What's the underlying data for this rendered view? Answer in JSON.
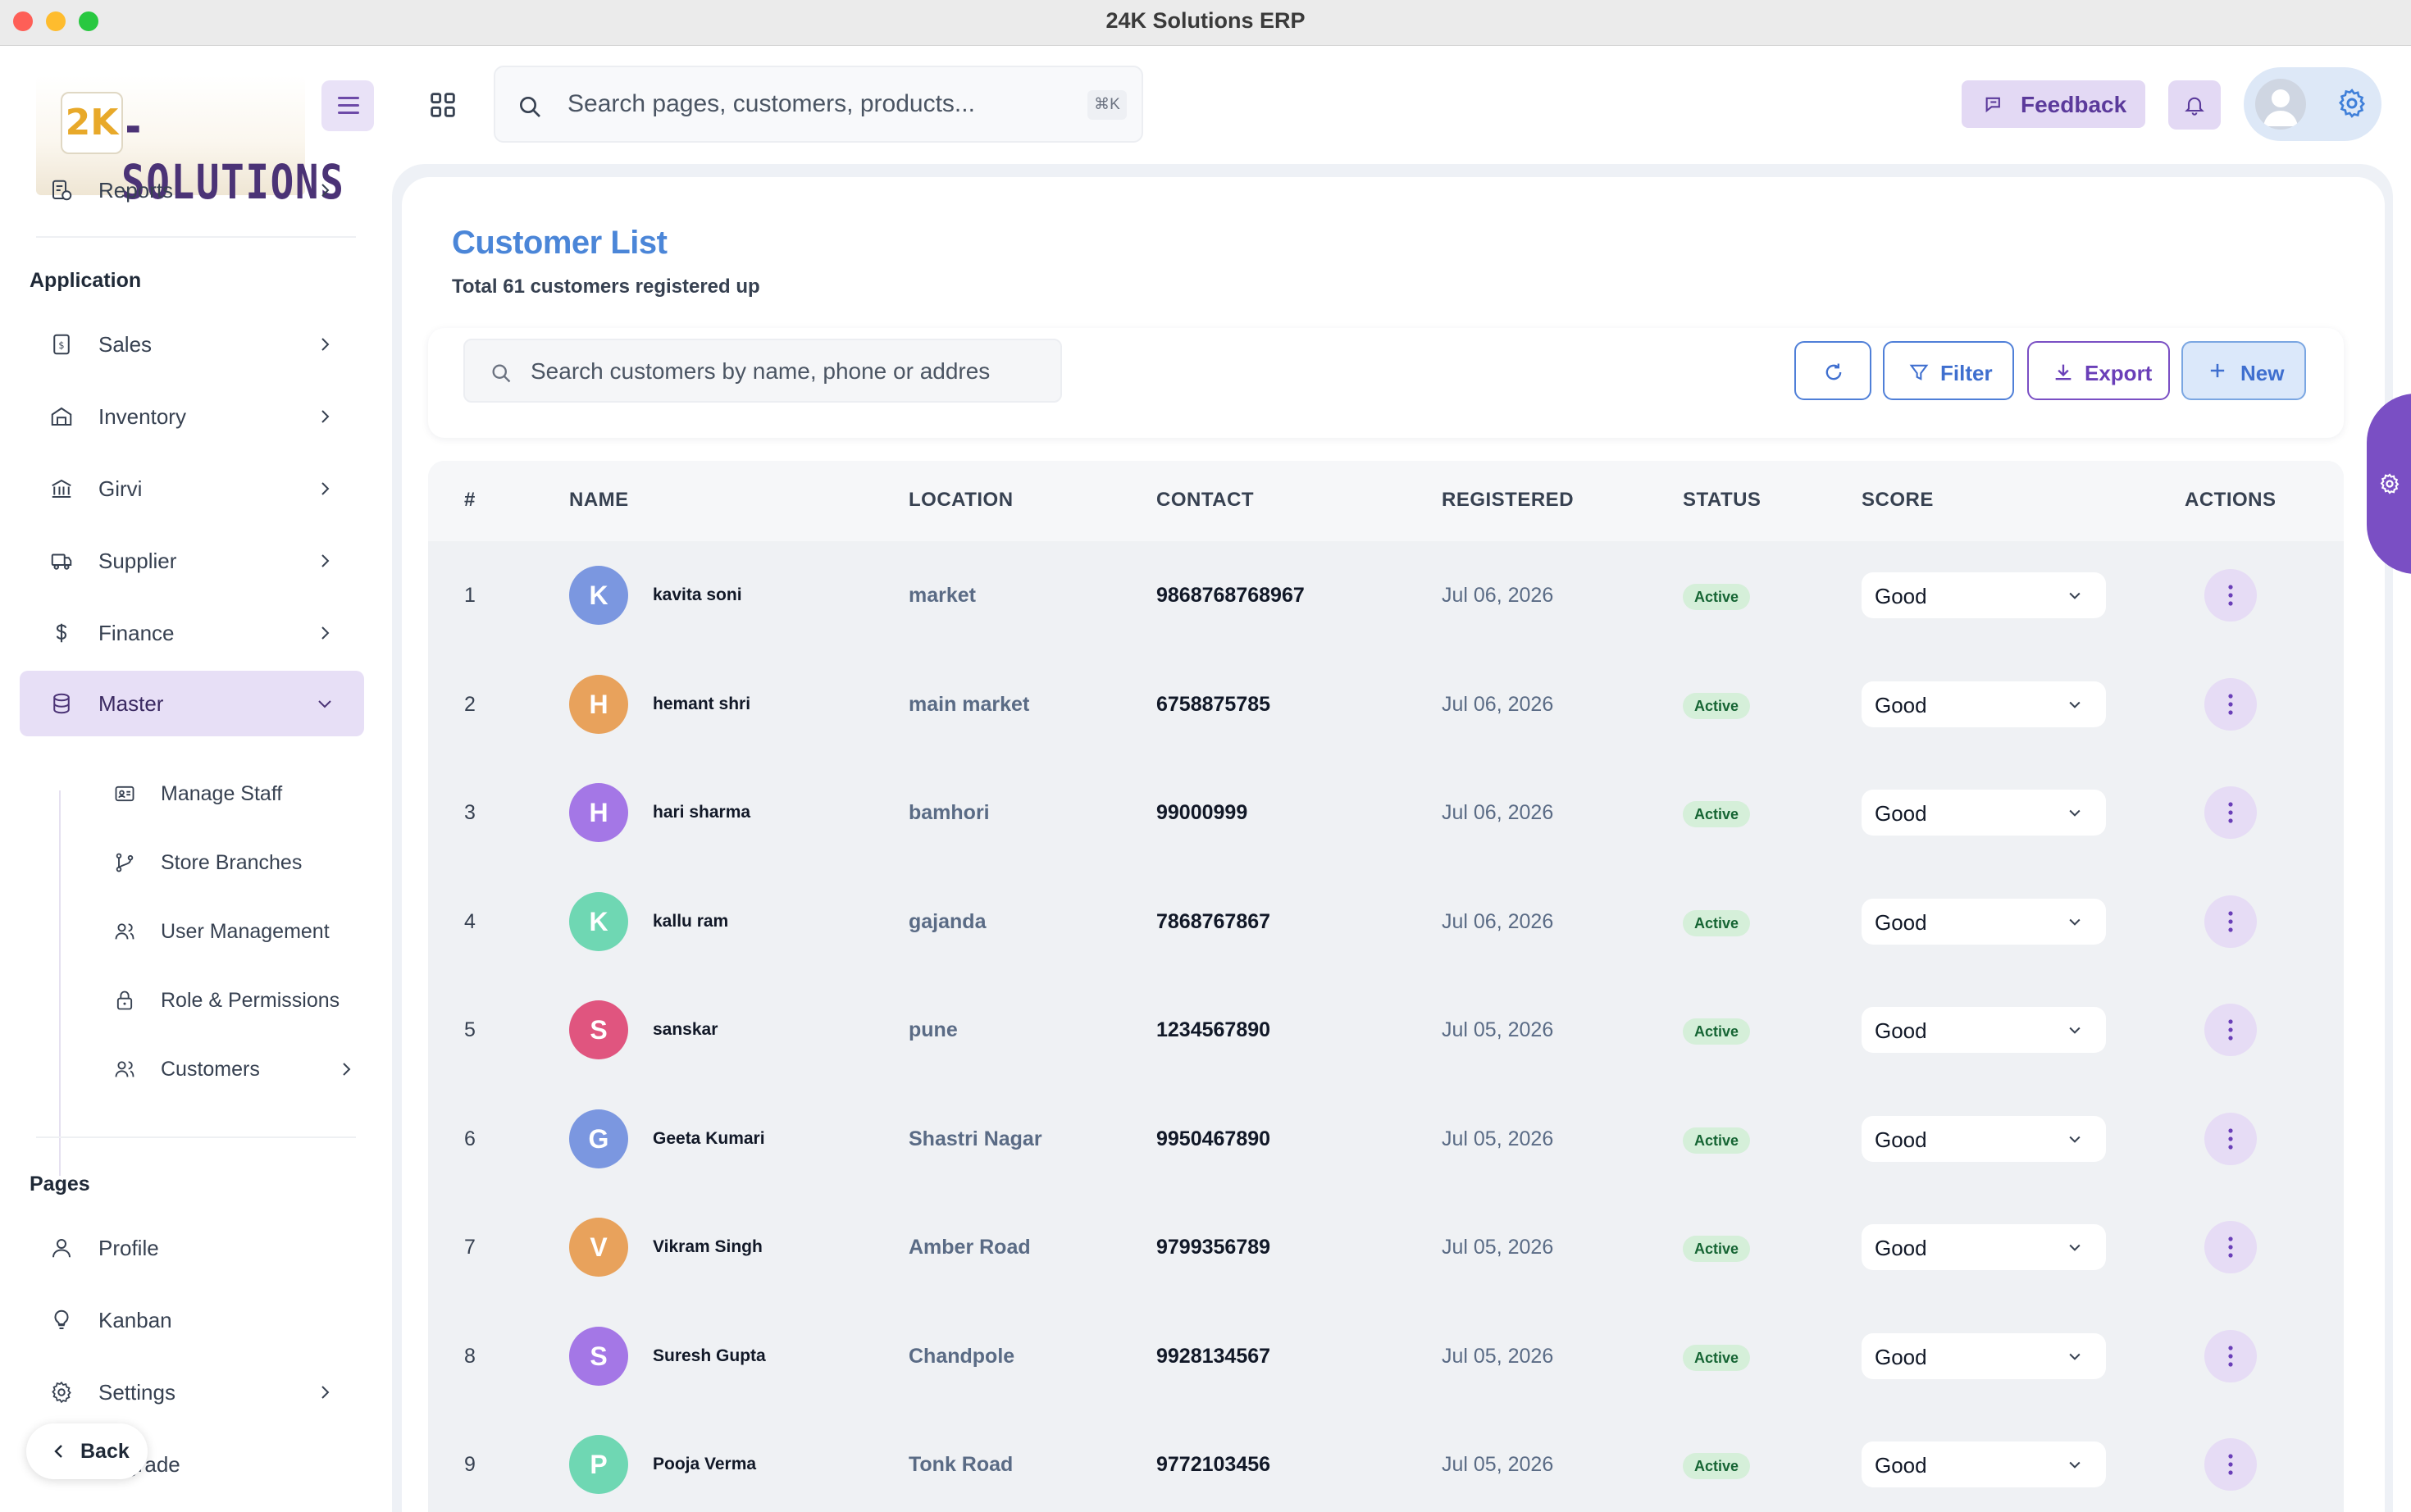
{
  "window": {
    "title": "24K Solutions ERP"
  },
  "logo": {
    "badge": "2K",
    "text": "-SOLUTIONS"
  },
  "sidebar": {
    "reports": "Reports",
    "section_application": "Application",
    "items": [
      {
        "label": "Sales"
      },
      {
        "label": "Inventory"
      },
      {
        "label": "Girvi"
      },
      {
        "label": "Supplier"
      },
      {
        "label": "Finance"
      },
      {
        "label": "Master"
      }
    ],
    "master_sub": [
      {
        "label": "Manage Staff"
      },
      {
        "label": "Store Branches"
      },
      {
        "label": "User Management"
      },
      {
        "label": "Role & Permissions"
      },
      {
        "label": "Customers"
      }
    ],
    "section_pages": "Pages",
    "pages": [
      {
        "label": "Profile"
      },
      {
        "label": "Kanban"
      },
      {
        "label": "Settings"
      },
      {
        "label": "Upgrade"
      }
    ],
    "back_label": "Back"
  },
  "header": {
    "search_placeholder": "Search pages, customers, products...",
    "shortcut": "⌘K",
    "feedback_label": "Feedback"
  },
  "page": {
    "title": "Customer List",
    "subtitle": "Total 61 customers registered up",
    "search_placeholder": "Search customers by name, phone or addres",
    "filter_label": "Filter",
    "export_label": "Export",
    "new_label": "New"
  },
  "table": {
    "columns": [
      "#",
      "NAME",
      "LOCATION",
      "CONTACT",
      "REGISTERED",
      "STATUS",
      "SCORE",
      "ACTIONS"
    ],
    "rows": [
      {
        "idx": "1",
        "initial": "K",
        "name": "kavita soni",
        "location": "market",
        "contact": "9868768768967",
        "registered": "Jul 06, 2026",
        "status": "Active",
        "score": "Good",
        "color": "#7b97e0"
      },
      {
        "idx": "2",
        "initial": "H",
        "name": "hemant shri",
        "location": "main market",
        "contact": "6758875785",
        "registered": "Jul 06, 2026",
        "status": "Active",
        "score": "Good",
        "color": "#e8a25c"
      },
      {
        "idx": "3",
        "initial": "H",
        "name": "hari sharma",
        "location": "bamhori",
        "contact": "99000999",
        "registered": "Jul 06, 2026",
        "status": "Active",
        "score": "Good",
        "color": "#a477e6"
      },
      {
        "idx": "4",
        "initial": "K",
        "name": "kallu ram",
        "location": "gajanda",
        "contact": "7868767867",
        "registered": "Jul 06, 2026",
        "status": "Active",
        "score": "Good",
        "color": "#6fd7b3"
      },
      {
        "idx": "5",
        "initial": "S",
        "name": "sanskar",
        "location": "pune",
        "contact": "1234567890",
        "registered": "Jul 05, 2026",
        "status": "Active",
        "score": "Good",
        "color": "#e0557f"
      },
      {
        "idx": "6",
        "initial": "G",
        "name": "Geeta Kumari",
        "location": "Shastri Nagar",
        "contact": "9950467890",
        "registered": "Jul 05, 2026",
        "status": "Active",
        "score": "Good",
        "color": "#7b97e0"
      },
      {
        "idx": "7",
        "initial": "V",
        "name": "Vikram Singh",
        "location": "Amber Road",
        "contact": "9799356789",
        "registered": "Jul 05, 2026",
        "status": "Active",
        "score": "Good",
        "color": "#e8a25c"
      },
      {
        "idx": "8",
        "initial": "S",
        "name": "Suresh Gupta",
        "location": "Chandpole",
        "contact": "9928134567",
        "registered": "Jul 05, 2026",
        "status": "Active",
        "score": "Good",
        "color": "#a477e6"
      },
      {
        "idx": "9",
        "initial": "P",
        "name": "Pooja Verma",
        "location": "Tonk Road",
        "contact": "9772103456",
        "registered": "Jul 05, 2026",
        "status": "Active",
        "score": "Good",
        "color": "#6fd7b3"
      }
    ]
  },
  "colors": {
    "accent": "#7a4fc4",
    "primary": "#4f7fd8",
    "active_bg": "#e7dff6"
  },
  "icons": [
    "hamburger-icon",
    "grid-icon",
    "search-icon",
    "message-icon",
    "bell-icon",
    "gear-icon",
    "refresh-icon",
    "filter-icon",
    "download-icon",
    "plus-icon",
    "chevron-right-icon",
    "chevron-down-icon",
    "more-vertical-icon"
  ]
}
